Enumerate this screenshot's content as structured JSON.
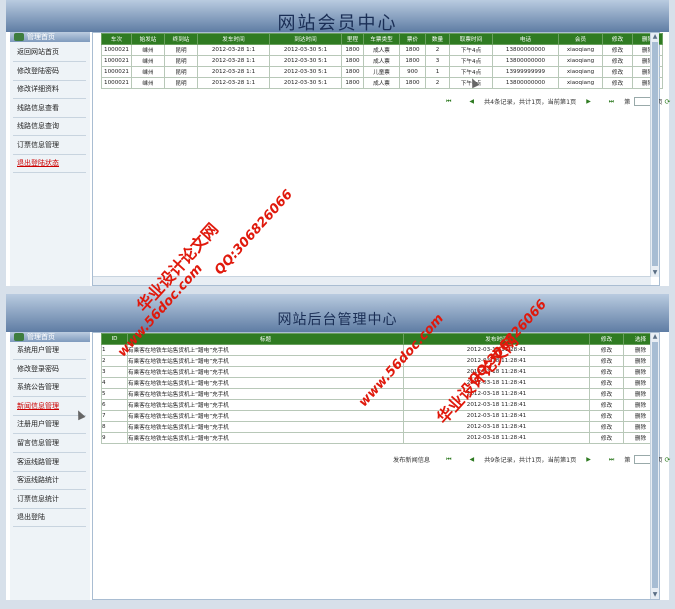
{
  "member_page": {
    "title": "网站会员中心",
    "sidebar_title": "管理首页",
    "sidebar_items": [
      "返回网站首页",
      "修改登陆密码",
      "修改详细资料",
      "线路信息查看",
      "线路信息查询",
      "订票信息管理",
      "退出登陆状态"
    ],
    "active_item": 6,
    "table": {
      "columns": [
        "车次",
        "始发站",
        "终到站",
        "发车时间",
        "到达时间",
        "里程",
        "车票类型",
        "票价",
        "数量",
        "取票时间",
        "电话",
        "会员",
        "修改",
        "删除"
      ],
      "rows": [
        [
          "1000021",
          "嵊州",
          "昆明",
          "2012-03-28 1:1",
          "2012-03-30 5:1",
          "1800",
          "成人票",
          "1800",
          "2",
          "下午4点",
          "13800000000",
          "xiaoqiang",
          "修改",
          "删除"
        ],
        [
          "1000021",
          "嵊州",
          "昆明",
          "2012-03-28 1:1",
          "2012-03-30 5:1",
          "1800",
          "成人票",
          "1800",
          "3",
          "下午4点",
          "13800000000",
          "xiaoqiang",
          "修改",
          "删除"
        ],
        [
          "1000021",
          "嵊州",
          "昆明",
          "2012-03-28 1:1",
          "2012-03-30 5:1",
          "1800",
          "儿童票",
          "900",
          "1",
          "下午4点",
          "13999999999",
          "xiaoqiang",
          "修改",
          "删除"
        ],
        [
          "1000021",
          "嵊州",
          "昆明",
          "2012-03-28 1:1",
          "2012-03-30 5:1",
          "1800",
          "成人票",
          "1800",
          "2",
          "下午4点",
          "13800000000",
          "xiaoqiang",
          "修改",
          "删除"
        ]
      ]
    },
    "pager": {
      "first": "⏮",
      "prev": "◀",
      "summary": "共4条记录，共计1页，当前第1页",
      "next": "▶",
      "last": "⏭",
      "page_label": "第",
      "page_suffix": "页",
      "go": "⟳"
    }
  },
  "admin_page": {
    "title": "网站后台管理中心",
    "sidebar_title": "管理首页",
    "sidebar_items": [
      "系统用户管理",
      "修改登录密码",
      "系统公告管理",
      "新闻信息管理",
      "注册用户管理",
      "留言信息管理",
      "客运线路管理",
      "客运线路统计",
      "订票信息统计",
      "退出登陆"
    ],
    "active_item": 3,
    "table": {
      "columns": [
        "ID",
        "标题",
        "发布时间",
        "修改",
        "选择"
      ],
      "rows": [
        [
          "1",
          "有乘客在地铁车站售货机上“蹭电”充手机",
          "2012-03-18 11:28:41",
          "修改",
          "删除"
        ],
        [
          "2",
          "有乘客在地铁车站售货机上“蹭电”充手机",
          "2012-03-18 11:28:41",
          "修改",
          "删除"
        ],
        [
          "3",
          "有乘客在地铁车站售货机上“蹭电”充手机",
          "2012-03-18 11:28:41",
          "修改",
          "删除"
        ],
        [
          "4",
          "有乘客在地铁车站售货机上“蹭电”充手机",
          "2012-03-18 11:28:41",
          "修改",
          "删除"
        ],
        [
          "5",
          "有乘客在地铁车站售货机上“蹭电”充手机",
          "2012-03-18 11:28:41",
          "修改",
          "删除"
        ],
        [
          "6",
          "有乘客在地铁车站售货机上“蹭电”充手机",
          "2012-03-18 11:28:41",
          "修改",
          "删除"
        ],
        [
          "7",
          "有乘客在地铁车站售货机上“蹭电”充手机",
          "2012-03-18 11:28:41",
          "修改",
          "删除"
        ],
        [
          "8",
          "有乘客在地铁车站售货机上“蹭电”充手机",
          "2012-03-18 11:28:41",
          "修改",
          "删除"
        ],
        [
          "9",
          "有乘客在地铁车站售货机上“蹭电”充手机",
          "2012-03-18 11:28:41",
          "修改",
          "删除"
        ]
      ]
    },
    "pager": {
      "add_link": "发布新闻信息",
      "first": "⏮",
      "prev": "◀",
      "summary": "共9条记录，共计1页，当前第1页",
      "next": "▶",
      "last": "⏭",
      "page_label": "第",
      "page_suffix": "页",
      "go": "⟳"
    }
  },
  "watermarks": [
    "华业设计论文网",
    "QQ:306826066",
    "www.56doc.com",
    "www.56doc.com",
    "QQ:306826066",
    "华业设计论文网"
  ],
  "colors": {
    "header_green": "#2f7b22",
    "banner_top": "#b9cbe0",
    "banner_bottom": "#5f7da4",
    "watermark_red": "#e0190c"
  }
}
